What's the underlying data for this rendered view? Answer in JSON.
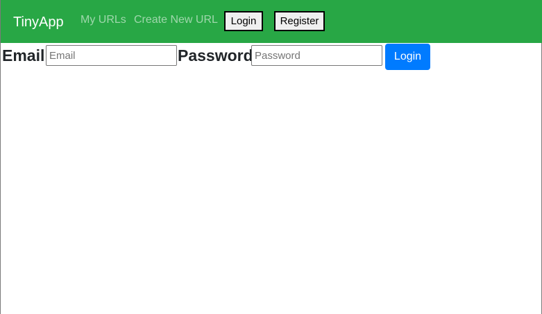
{
  "colors": {
    "navbar_bg": "#28a745",
    "primary_button": "#007bff"
  },
  "navbar": {
    "brand": "TinyApp",
    "links": [
      {
        "label": "My URLs"
      },
      {
        "label": "Create New URL"
      }
    ],
    "buttons": {
      "login": "Login",
      "register": "Register"
    }
  },
  "login_form": {
    "email_label": "Email",
    "email_placeholder": "Email",
    "email_value": "",
    "password_label": "Password",
    "password_placeholder": "Password",
    "password_value": "",
    "submit_label": "Login"
  }
}
